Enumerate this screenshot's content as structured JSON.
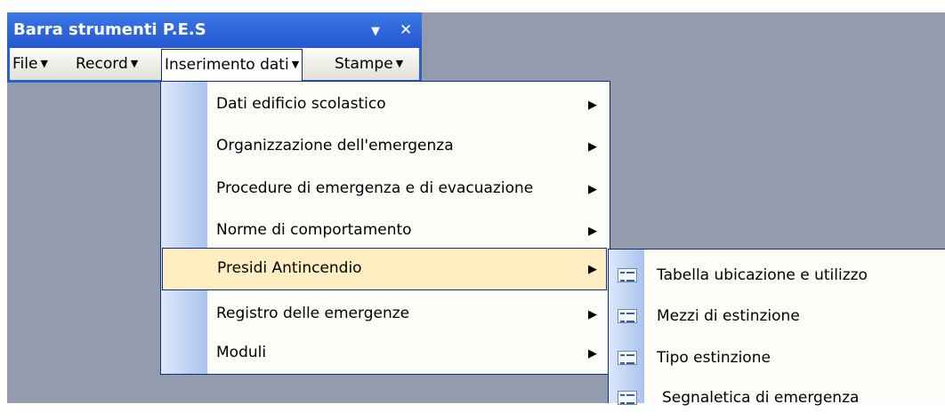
{
  "toolbar": {
    "title": "Barra strumenti P.E.S",
    "options_icon": "▼",
    "close_icon": "✕",
    "menus": [
      {
        "label": "File"
      },
      {
        "label": "Record"
      },
      {
        "label": "Inserimento dati"
      },
      {
        "label": "Stampe"
      }
    ],
    "caret": "▼"
  },
  "dropdown": {
    "items": [
      {
        "label": "Dati edificio scolastico"
      },
      {
        "label": "Organizzazione dell'emergenza"
      },
      {
        "label": "Procedure di emergenza e di evacuazione"
      },
      {
        "label": "Norme di comportamento"
      },
      {
        "label": "Presidi Antincendio"
      },
      {
        "label": "Registro delle emergenze"
      },
      {
        "label": "Moduli"
      }
    ],
    "submenu_arrow": "▶"
  },
  "submenu": {
    "items": [
      {
        "label": "Tabella ubicazione e utilizzo"
      },
      {
        "label": "Mezzi di estinzione"
      },
      {
        "label": "Tipo estinzione"
      },
      {
        "label": "Segnaletica di emergenza"
      }
    ]
  },
  "colors": {
    "desktop": "#939cad",
    "titlebar": "#2a5fd1",
    "highlight": "#ffeec2",
    "menu_border": "#0f2e8c"
  }
}
